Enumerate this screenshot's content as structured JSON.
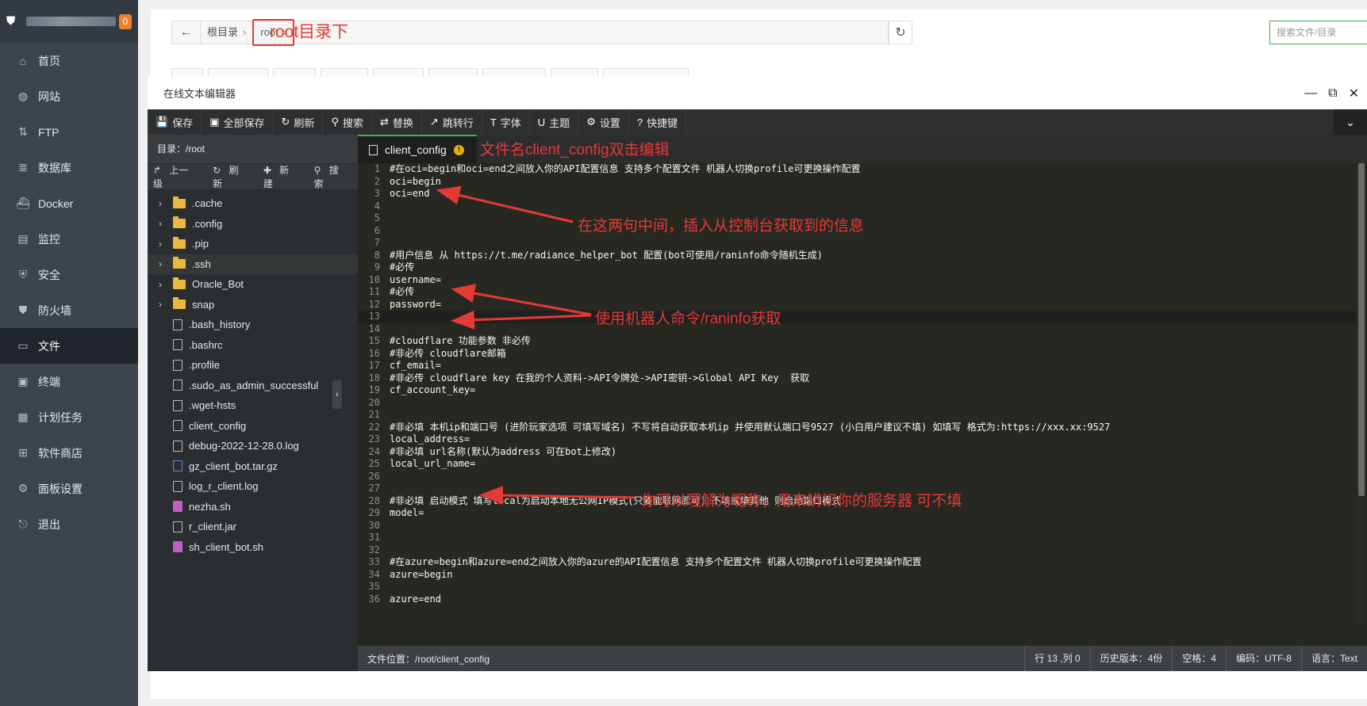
{
  "sidebar": {
    "badge": "0",
    "items": [
      {
        "label": "首页",
        "icon": "home-icon"
      },
      {
        "label": "网站",
        "icon": "globe-icon"
      },
      {
        "label": "FTP",
        "icon": "ftp-icon"
      },
      {
        "label": "数据库",
        "icon": "database-icon"
      },
      {
        "label": "Docker",
        "icon": "docker-icon"
      },
      {
        "label": "监控",
        "icon": "monitor-icon"
      },
      {
        "label": "安全",
        "icon": "security-icon"
      },
      {
        "label": "防火墙",
        "icon": "firewall-icon"
      },
      {
        "label": "文件",
        "icon": "folder-icon"
      },
      {
        "label": "终端",
        "icon": "terminal-icon"
      },
      {
        "label": "计划任务",
        "icon": "calendar-icon"
      },
      {
        "label": "软件商店",
        "icon": "apps-icon"
      },
      {
        "label": "面板设置",
        "icon": "settings-icon"
      },
      {
        "label": "退出",
        "icon": "logout-icon"
      }
    ],
    "active_index": 8
  },
  "pathbar": {
    "root_label": "根目录",
    "root_dir": "root",
    "annotation": "root目录下",
    "search_placeholder": "搜索文件/目录"
  },
  "editor": {
    "title": "在线文本编辑器",
    "toolbar": [
      "保存",
      "全部保存",
      "刷新",
      "搜索",
      "替换",
      "跳转行",
      "字体",
      "主题",
      "设置",
      "快捷键"
    ],
    "dir_label": "目录：/root",
    "file_actions": [
      "上一级",
      "刷新",
      "新建",
      "搜索"
    ],
    "folders": [
      ".cache",
      ".config",
      ".pip",
      ".ssh",
      "Oracle_Bot",
      "snap"
    ],
    "files": [
      {
        "name": ".bash_history",
        "type": "file"
      },
      {
        "name": ".bashrc",
        "type": "file"
      },
      {
        "name": ".profile",
        "type": "file"
      },
      {
        "name": ".sudo_as_admin_successful",
        "type": "file"
      },
      {
        "name": ".wget-hsts",
        "type": "file"
      },
      {
        "name": "client_config",
        "type": "file"
      },
      {
        "name": "debug-2022-12-28.0.log",
        "type": "file"
      },
      {
        "name": "gz_client_bot.tar.gz",
        "type": "archive"
      },
      {
        "name": "log_r_client.log",
        "type": "file"
      },
      {
        "name": "nezha.sh",
        "type": "script"
      },
      {
        "name": "r_client.jar",
        "type": "file"
      },
      {
        "name": "sh_client_bot.sh",
        "type": "script"
      }
    ],
    "tab_name": "client_config",
    "tab_annotation": "文件名client_config双击编辑",
    "lines": [
      "#在oci=begin和oci=end之间放入你的API配置信息 支持多个配置文件 机器人切换profile可更换操作配置",
      "oci=begin",
      "oci=end",
      "",
      "",
      "",
      "",
      "#用户信息 从 https://t.me/radiance_helper_bot 配置(bot可使用/raninfo命令随机生成)",
      "#必传",
      "username=",
      "#必传",
      "password=",
      "",
      "",
      "#cloudflare 功能参数 非必传",
      "#非必传 cloudflare邮箱",
      "cf_email=",
      "#非必传 cloudflare key 在我的个人资料->API令牌处->API密钥->Global API Key  获取",
      "cf_account_key=",
      "",
      "",
      "#非必填 本机ip和端口号 (进阶玩家选项 可填写域名) 不写将自动获取本机ip 并使用默认端口号9527 (小白用户建议不填) 如填写 格式为:https://xxx.xx:9527",
      "local_address=",
      "#非必填 url名称(默认为address 可在bot上修改)",
      "local_url_name=",
      "",
      "",
      "#非必填 启动模式 填写local为启动本地无公网IP模式(只要能联网即可) 不填或填其他 则启动端口模式",
      "model=",
      "",
      "",
      "",
      "#在azure=begin和azure=end之间放入你的azure的API配置信息 支持多个配置文件 机器人切换profile可更换操作配置",
      "azure=begin",
      "",
      "azure=end"
    ],
    "active_line": 13,
    "annotations": {
      "insert": "在这两句中间，插入从控制台获取到的信息",
      "raninfo": "使用机器人命令/raninfo获取",
      "nickname": "你可以理解为昵称，用来辨识你的服务器  可不填"
    },
    "status": {
      "location": "文件位置：/root/client_config",
      "cursor": "行 13 ,列 0",
      "history": "历史版本：4份",
      "indent": "空格：4",
      "encoding": "编码：UTF-8",
      "language": "语言：Text"
    }
  },
  "colors": {
    "accent": "#3cb14a",
    "annotation": "#e53935",
    "sidebar_bg": "#3c444d"
  }
}
